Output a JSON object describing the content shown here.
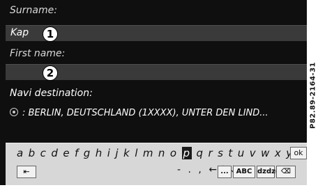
{
  "form": {
    "surname_label": "Surname:",
    "surname_value": "Kap",
    "firstname_label": "First name:",
    "firstname_value": "",
    "navi_label": "Navi destination:",
    "navi_value": ": BERLIN, DEUTSCHLAND (1XXXX), UNTER DEN LIND..."
  },
  "callouts": {
    "one": "1",
    "two": "2"
  },
  "keyboard": {
    "letters_before": "a b c d e f g h i j k l m n o ",
    "selected_letter": "p",
    "letters_after": " q r s t u v w x y z _",
    "ok_label": "ok",
    "back_icon": "return-icon",
    "punctuation": "- . ,",
    "arrows": "←↑↓→",
    "ellipsis_label": "...",
    "abc_label": "ABC",
    "char_set_label": "ǳǳǳ",
    "delete_icon": "backspace-icon"
  },
  "side_code": "P82.89-2164-31",
  "colors": {
    "screen_bg": "#0f0f0f",
    "field_bg": "#3a3a3a",
    "keyboard_bg": "#d7d7d7",
    "selected_key_bg": "#1a1a1a"
  }
}
